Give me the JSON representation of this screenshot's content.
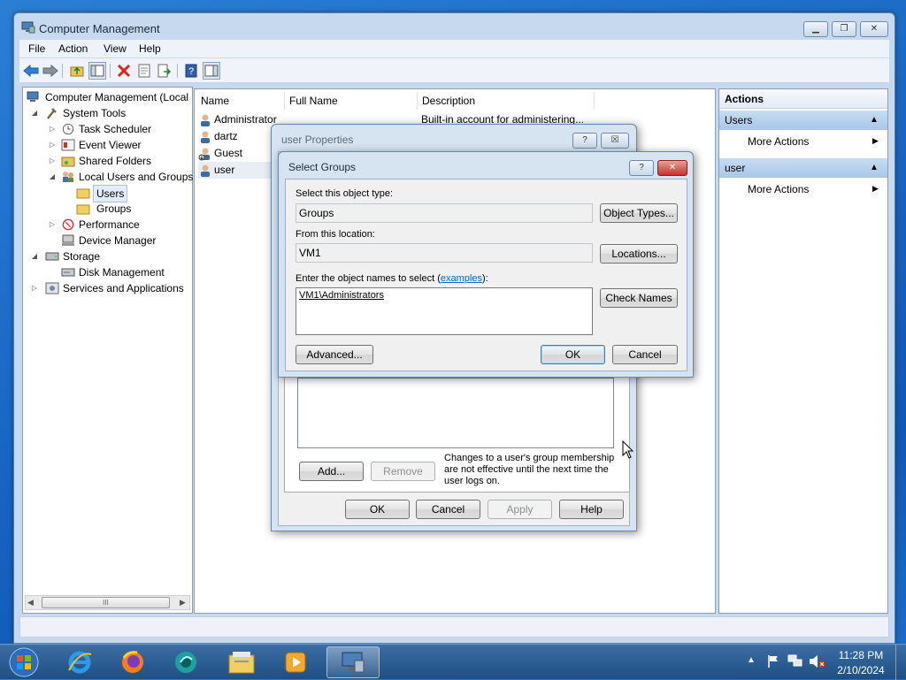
{
  "window": {
    "title": "Computer Management",
    "menu": [
      "File",
      "Action",
      "View",
      "Help"
    ]
  },
  "tree": {
    "root": "Computer Management (Local",
    "system_tools": "System Tools",
    "task_scheduler": "Task Scheduler",
    "event_viewer": "Event Viewer",
    "shared_folders": "Shared Folders",
    "local_users_groups": "Local Users and Groups",
    "users": "Users",
    "groups": "Groups",
    "performance": "Performance",
    "device_manager": "Device Manager",
    "storage": "Storage",
    "disk_management": "Disk Management",
    "services_apps": "Services and Applications",
    "scroll_grip": "III"
  },
  "list": {
    "columns": [
      "Name",
      "Full Name",
      "Description"
    ],
    "rows": [
      {
        "name": "Administrator",
        "full_name": "",
        "description": "Built-in account for administering..."
      },
      {
        "name": "dartz",
        "full_name": "",
        "description": ""
      },
      {
        "name": "Guest",
        "full_name": "",
        "description": ""
      },
      {
        "name": "user",
        "full_name": "",
        "description": ""
      }
    ]
  },
  "actions": {
    "header": "Actions",
    "section1": "Users",
    "section1_item": "More Actions",
    "section2": "user",
    "section2_item": "More Actions"
  },
  "user_props": {
    "title": "user Properties",
    "help_glyph": "?",
    "close_glyph": "☒",
    "add": "Add...",
    "remove": "Remove",
    "note": "Changes to a user's group membership are not effective until the next time the user logs on.",
    "ok": "OK",
    "cancel": "Cancel",
    "apply": "Apply",
    "help": "Help"
  },
  "select_groups": {
    "title": "Select Groups",
    "help_glyph": "?",
    "close_glyph": "✕",
    "object_type_label": "Select this object type:",
    "object_type_value": "Groups",
    "object_types_btn": "Object Types...",
    "location_label": "From this location:",
    "location_value": "VM1",
    "locations_btn": "Locations...",
    "names_label_prefix": "Enter the object names to select (",
    "names_label_link": "examples",
    "names_label_suffix": "):",
    "names_value": "VM1\\Administrators",
    "check_names_btn": "Check Names",
    "advanced_btn": "Advanced...",
    "ok": "OK",
    "cancel": "Cancel"
  },
  "taskbar": {
    "time": "11:28 PM",
    "date": "2/10/2024"
  },
  "colors": {
    "accent": "#2a7fd4",
    "close_red": "#c9302c",
    "link": "#0066cc"
  }
}
